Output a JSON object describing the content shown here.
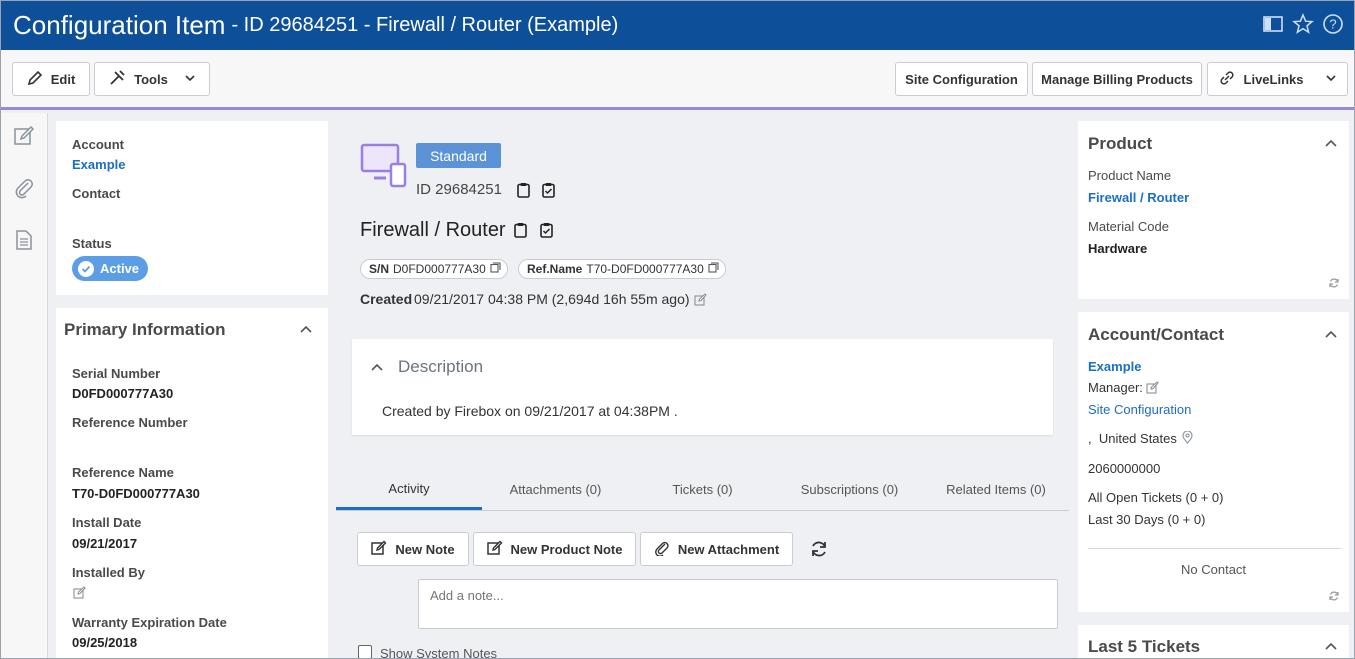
{
  "header": {
    "title": "Configuration Item",
    "subtitle": "- ID 29684251 - Firewall / Router (Example)"
  },
  "toolbar": {
    "edit_label": "Edit",
    "tools_label": "Tools",
    "site_config_label": "Site Configuration",
    "billing_label": "Manage Billing Products",
    "livelinks_label": "LiveLinks"
  },
  "left_summary": {
    "account_label": "Account",
    "account_value": "Example",
    "contact_label": "Contact",
    "status_label": "Status",
    "status_value": "Active"
  },
  "primary_info": {
    "title": "Primary Information",
    "serial_label": "Serial Number",
    "serial_value": "D0FD000777A30",
    "ref_number_label": "Reference Number",
    "ref_name_label": "Reference Name",
    "ref_name_value": "T70-D0FD000777A30",
    "install_date_label": "Install Date",
    "install_date_value": "09/21/2017",
    "installed_by_label": "Installed By",
    "warranty_label": "Warranty Expiration Date",
    "warranty_value": "09/25/2018"
  },
  "main": {
    "badge": "Standard",
    "id_text": "ID 29684251",
    "name": "Firewall / Router",
    "sn_label": "S/N",
    "sn_value": "D0FD000777A30",
    "refname_label": "Ref.Name",
    "refname_value": "T70-D0FD000777A30",
    "created_label": "Created",
    "created_value": "09/21/2017 04:38 PM (2,694d 16h 55m ago)",
    "description_title": "Description",
    "description_text": "Created by Firebox on 09/21/2017 at 04:38PM ."
  },
  "tabs": [
    "Activity",
    "Attachments (0)",
    "Tickets (0)",
    "Subscriptions (0)",
    "Related Items (0)"
  ],
  "activity": {
    "new_note": "New Note",
    "new_product_note": "New Product Note",
    "new_attachment": "New Attachment",
    "note_placeholder": "Add a note...",
    "show_system_notes": "Show System Notes"
  },
  "product": {
    "title": "Product",
    "name_label": "Product Name",
    "name_value": "Firewall / Router",
    "material_label": "Material Code",
    "material_value": "Hardware"
  },
  "account_contact": {
    "title": "Account/Contact",
    "account": "Example",
    "manager_label": "Manager:",
    "site_config": "Site Configuration",
    "country": ",  United States",
    "phone": "2060000000",
    "open_tickets": "All Open Tickets (0 + 0)",
    "last_30": "Last 30 Days (0 + 0)",
    "no_contact": "No Contact"
  },
  "last_tickets": {
    "title": "Last 5 Tickets"
  },
  "colors": {
    "header_bg": "#0e4f9a",
    "accent_line": "#9b86e0",
    "link": "#1a6fc4",
    "status_active": "#5b9ee6",
    "badge_standard": "#5b93d6"
  }
}
